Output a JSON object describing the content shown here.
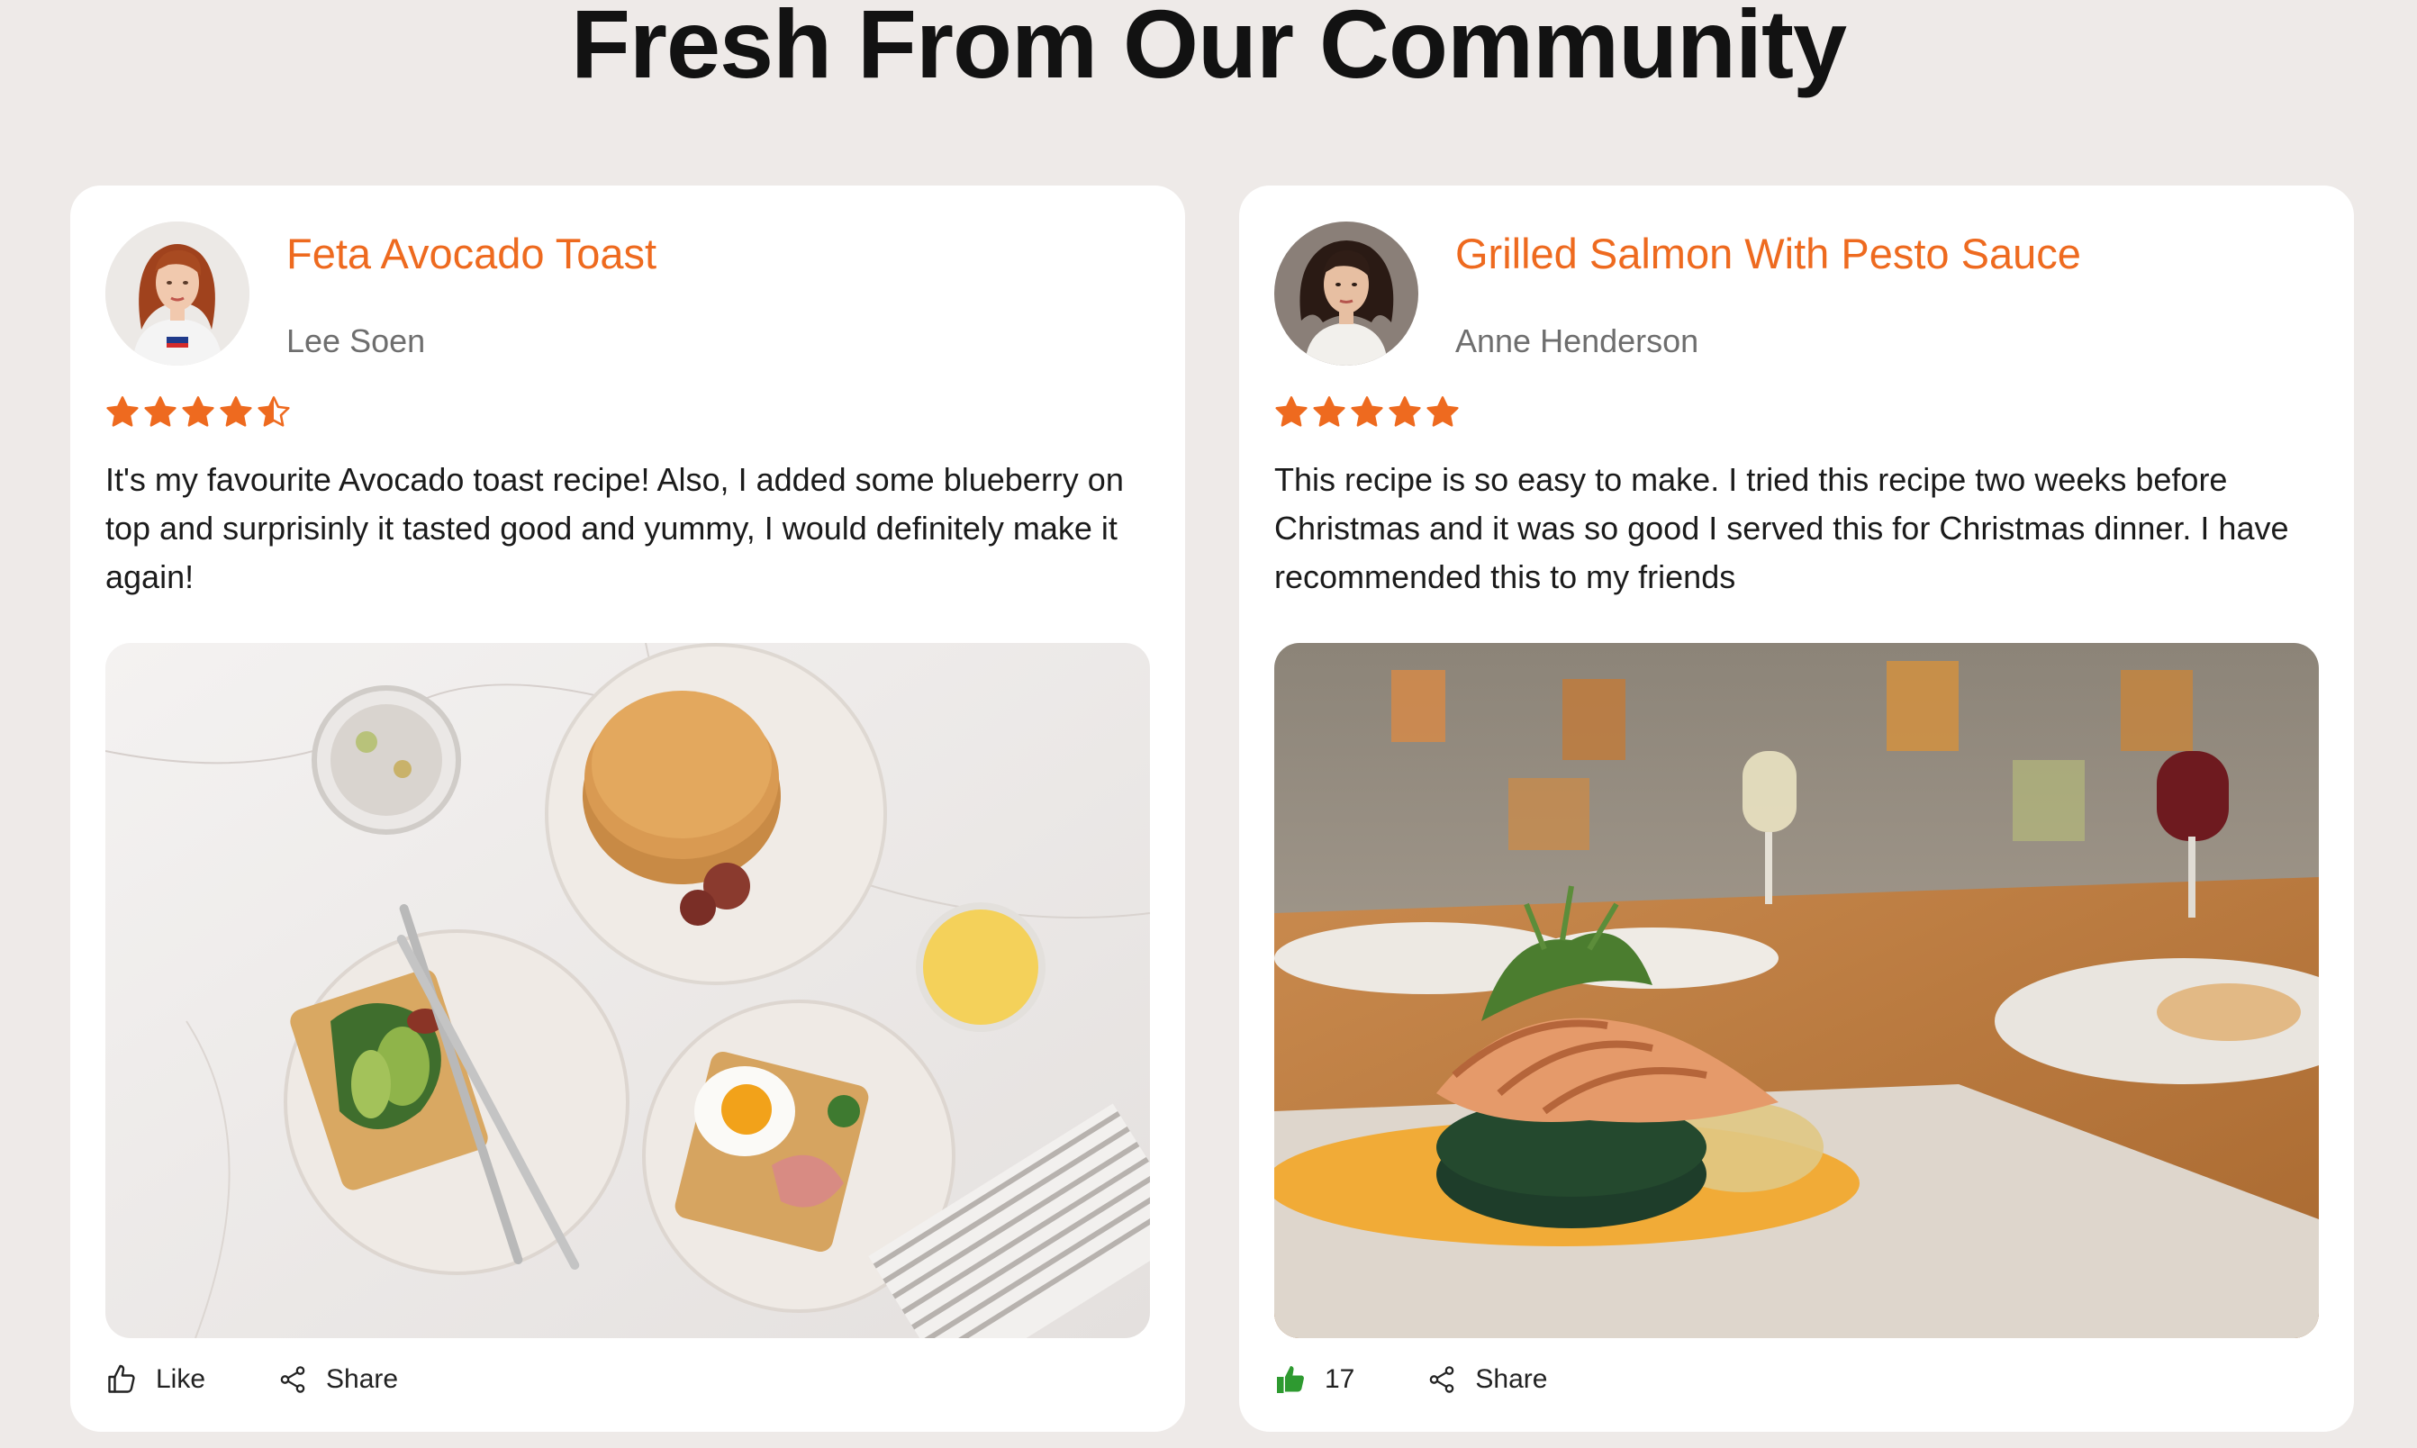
{
  "section_title": "Fresh From Our Community",
  "colors": {
    "accent": "#ee6a1f",
    "liked": "#2e9a30",
    "background": "#eeeae8"
  },
  "cards": [
    {
      "recipe_title": "Feta Avocado Toast",
      "author": "Lee Soen",
      "rating": 4.5,
      "rating_max": 5,
      "review": "It's my favourite Avocado toast recipe! Also, I added some blueberry on top and surprisinly it tasted good and yummy, I would definitely make it again!",
      "like_label": "Like",
      "share_label": "Share",
      "liked": false
    },
    {
      "recipe_title": "Grilled Salmon With Pesto Sauce",
      "author": "Anne Henderson",
      "rating": 5,
      "rating_max": 5,
      "review": "This recipe is so easy to make. I tried this recipe two weeks before Christmas and it was so good I served this for Christmas dinner. I have recommended this to my friends",
      "like_label": "17",
      "share_label": "Share",
      "liked": true
    }
  ]
}
